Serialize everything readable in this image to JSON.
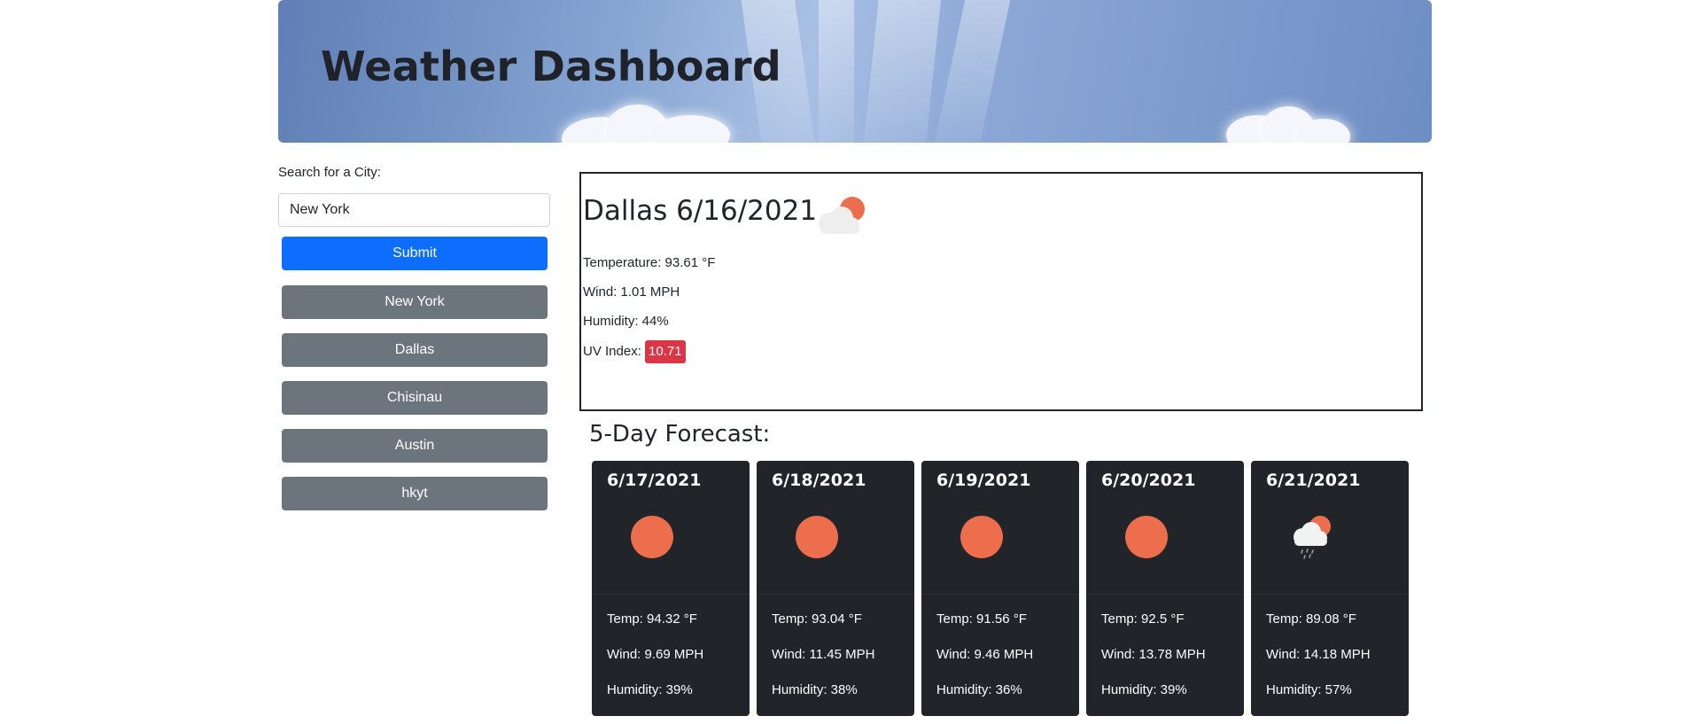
{
  "header": {
    "title": "Weather Dashboard"
  },
  "search": {
    "label": "Search for a City:",
    "value": "New York",
    "submit_label": "Submit"
  },
  "history": [
    {
      "label": "New York"
    },
    {
      "label": "Dallas"
    },
    {
      "label": "Chisinau"
    },
    {
      "label": "Austin"
    },
    {
      "label": "hkyt"
    }
  ],
  "current": {
    "title": "Dallas 6/16/2021",
    "icon": "sun-behind-cloud-icon",
    "temperature": "Temperature: 93.61 °F",
    "wind": "Wind: 1.01 MPH",
    "humidity": "Humidity: 44%",
    "uv_label": "UV Index:",
    "uv_value": "10.71"
  },
  "forecast": {
    "heading": "5-Day Forecast:",
    "days": [
      {
        "date": "6/17/2021",
        "icon": "sun-icon",
        "temp": "Temp: 94.32 °F",
        "wind": "Wind: 9.69 MPH",
        "humidity": "Humidity: 39%"
      },
      {
        "date": "6/18/2021",
        "icon": "sun-icon",
        "temp": "Temp: 93.04 °F",
        "wind": "Wind: 11.45 MPH",
        "humidity": "Humidity: 38%"
      },
      {
        "date": "6/19/2021",
        "icon": "sun-icon",
        "temp": "Temp: 91.56 °F",
        "wind": "Wind: 9.46 MPH",
        "humidity": "Humidity: 36%"
      },
      {
        "date": "6/20/2021",
        "icon": "sun-icon",
        "temp": "Temp: 92.5 °F",
        "wind": "Wind: 13.78 MPH",
        "humidity": "Humidity: 39%"
      },
      {
        "date": "6/21/2021",
        "icon": "rain-cloud-sun-icon",
        "temp": "Temp: 89.08 °F",
        "wind": "Wind: 14.18 MPH",
        "humidity": "Humidity: 57%"
      }
    ]
  },
  "colors": {
    "primary": "#0d6efd",
    "secondary": "#6c757d",
    "danger": "#dc3545",
    "card_dark": "#212529",
    "sun": "#ec6e4c"
  }
}
